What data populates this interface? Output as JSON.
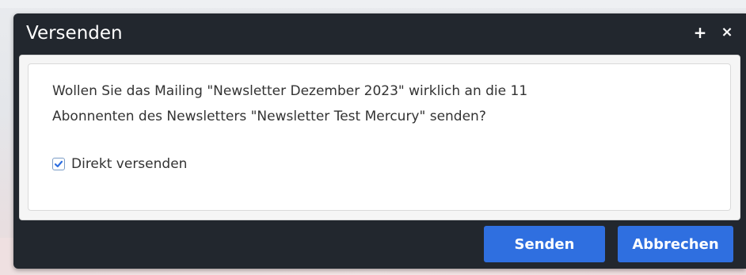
{
  "dialog": {
    "title": "Versenden",
    "maximize_icon": "plus-icon",
    "close_icon": "close-icon",
    "maximize_glyph": "+",
    "close_glyph": "×"
  },
  "message": {
    "line1": "Wollen Sie das Mailing \"Newsletter Dezember 2023\" wirklich an die 11",
    "line2": "Abonnenten des Newsletters \"Newsletter Test Mercury\" senden?"
  },
  "options": {
    "direct_send_label": "Direkt versenden",
    "direct_send_checked": true
  },
  "buttons": {
    "send_label": "Senden",
    "cancel_label": "Abbrechen"
  },
  "colors": {
    "dialog_background": "#22272e",
    "button_primary": "#2f6fe0",
    "checkbox_check": "#2f6fe0"
  }
}
